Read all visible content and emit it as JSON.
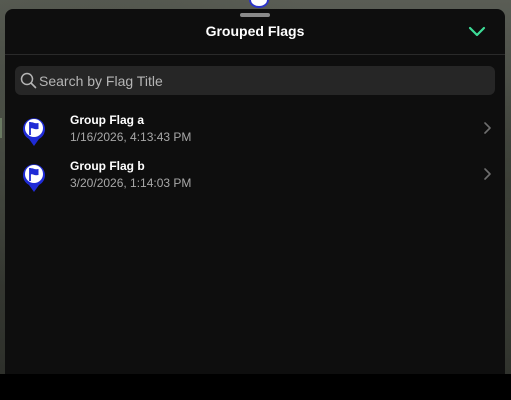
{
  "panel": {
    "title": "Grouped Flags"
  },
  "search": {
    "placeholder": "Search by Flag Title",
    "value": ""
  },
  "flags": [
    {
      "title": "Group Flag a",
      "date": "1/16/2026, 4:13:43 PM"
    },
    {
      "title": "Group Flag b",
      "date": "3/20/2026, 1:14:03 PM"
    }
  ],
  "icons": {
    "collapse": "chevron-down-icon",
    "search": "search-icon",
    "flag": "flag-pin-icon",
    "row_open": "chevron-right-icon"
  },
  "colors": {
    "panel_bg": "#0e0e0e",
    "accent_green": "#3ddc97",
    "flag_blue": "#1f2bd6",
    "text_primary": "#ffffff",
    "text_secondary": "#a8a8a8"
  }
}
